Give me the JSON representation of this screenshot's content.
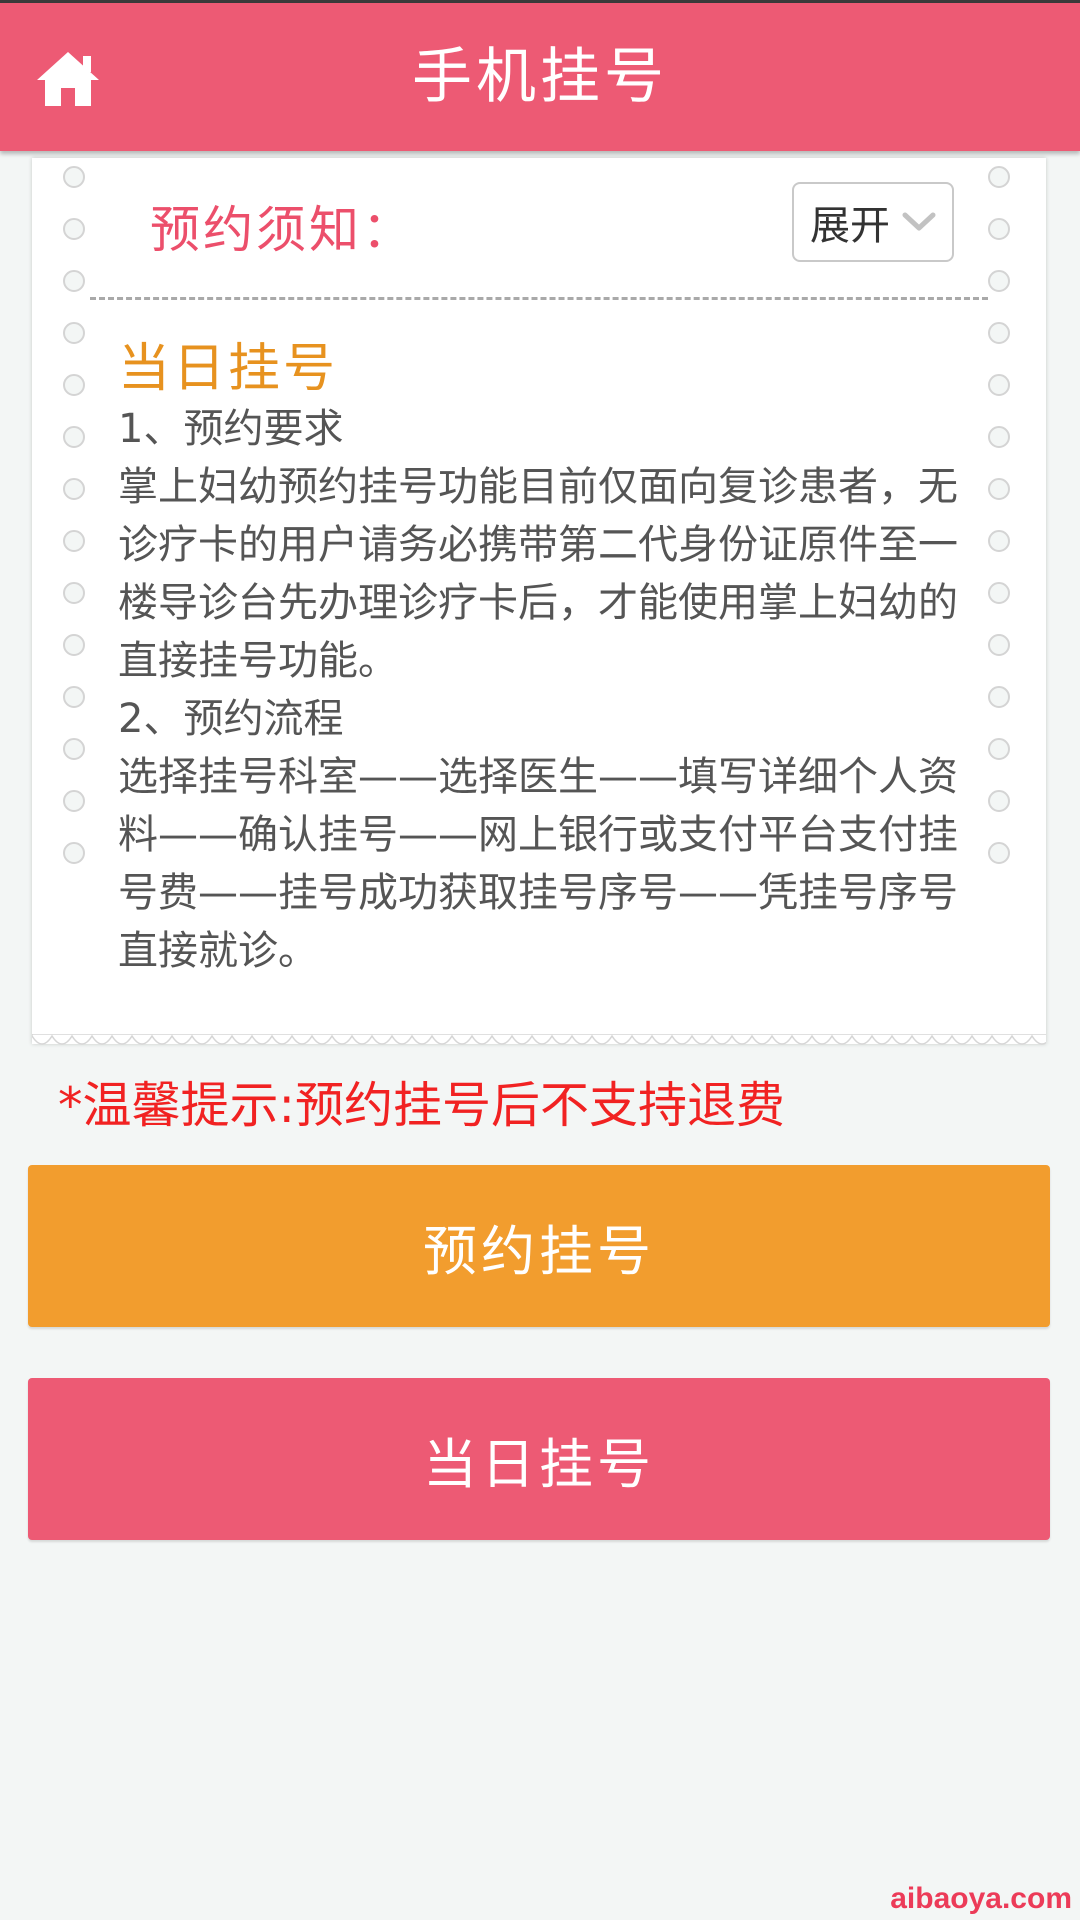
{
  "header": {
    "title": "手机挂号"
  },
  "notice": {
    "title": "预约须知：",
    "toggle_label": "展开",
    "section_title": "当日挂号",
    "lines": [
      "1、预约要求",
      "掌上妇幼预约挂号功能目前仅面向复诊患者，无诊疗卡的用户请务必携带第二代身份证原件至一楼导诊台先办理诊疗卡后，才能使用掌上妇幼的直接挂号功能。",
      "2、预约流程",
      "选择挂号科室——选择医生——填写详细个人资料——确认挂号——网上银行或支付平台支付挂号费——挂号成功获取挂号序号——凭挂号序号直接就诊。"
    ]
  },
  "warning": "*温馨提示:预约挂号后不支持退费",
  "buttons": {
    "appointment": "预约挂号",
    "same_day": "当日挂号"
  },
  "watermark": "aibaoya.com",
  "colors": {
    "brand_pink": "#ed5a74",
    "accent_orange": "#f29d2e",
    "warning_red": "#f12222"
  },
  "icons": {
    "home": "home-icon",
    "toggle": "chevron-down-icon"
  }
}
